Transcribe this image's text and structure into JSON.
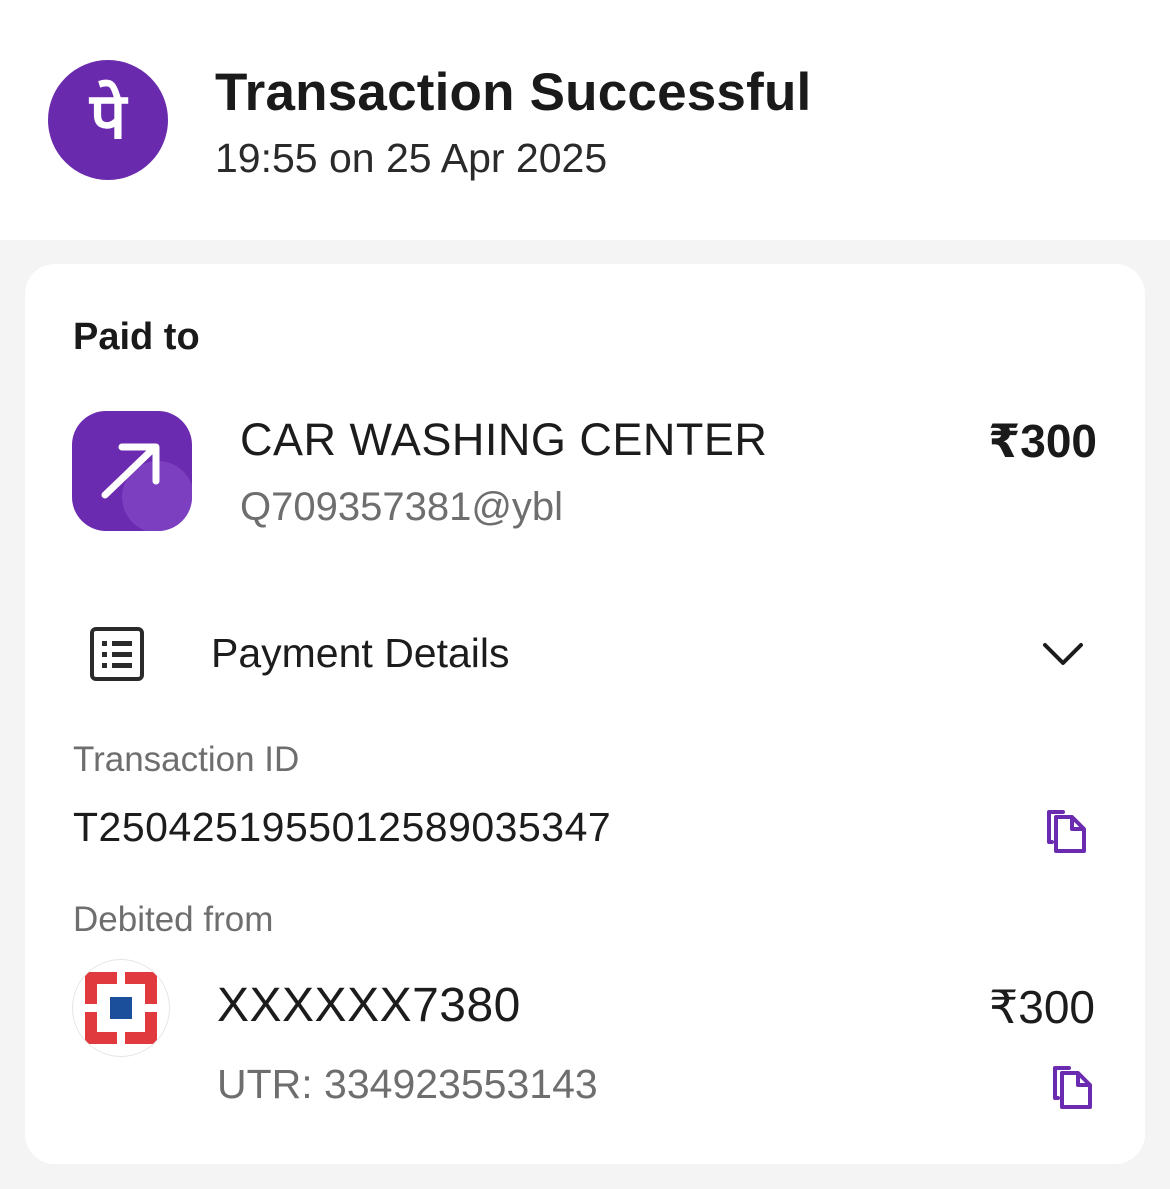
{
  "header": {
    "logo_glyph": "पे",
    "title": "Transaction Successful",
    "timestamp": "19:55 on 25 Apr 2025"
  },
  "paid_to": {
    "label": "Paid to",
    "name": "CAR WASHING CENTER",
    "vpa": "Q709357381@ybl",
    "amount": "₹300"
  },
  "payment_details": {
    "label": "Payment Details"
  },
  "transaction": {
    "label": "Transaction ID",
    "id": "T2504251955012589035347"
  },
  "debited_from": {
    "label": "Debited from",
    "account": "XXXXXX7380",
    "utr": "UTR: 334923553143",
    "amount": "₹300"
  },
  "colors": {
    "brand_purple": "#6a2aad",
    "accent_purple": "#6b2bb0",
    "bank_red": "#e03a3e",
    "bank_blue": "#1b4f9c"
  },
  "icons": {
    "brand": "phonepe-logo-icon",
    "merchant": "arrow-up-right-icon",
    "details": "receipt-list-icon",
    "expand": "chevron-down-icon",
    "copy": "copy-icon",
    "bank": "hdfc-bank-logo-icon"
  }
}
